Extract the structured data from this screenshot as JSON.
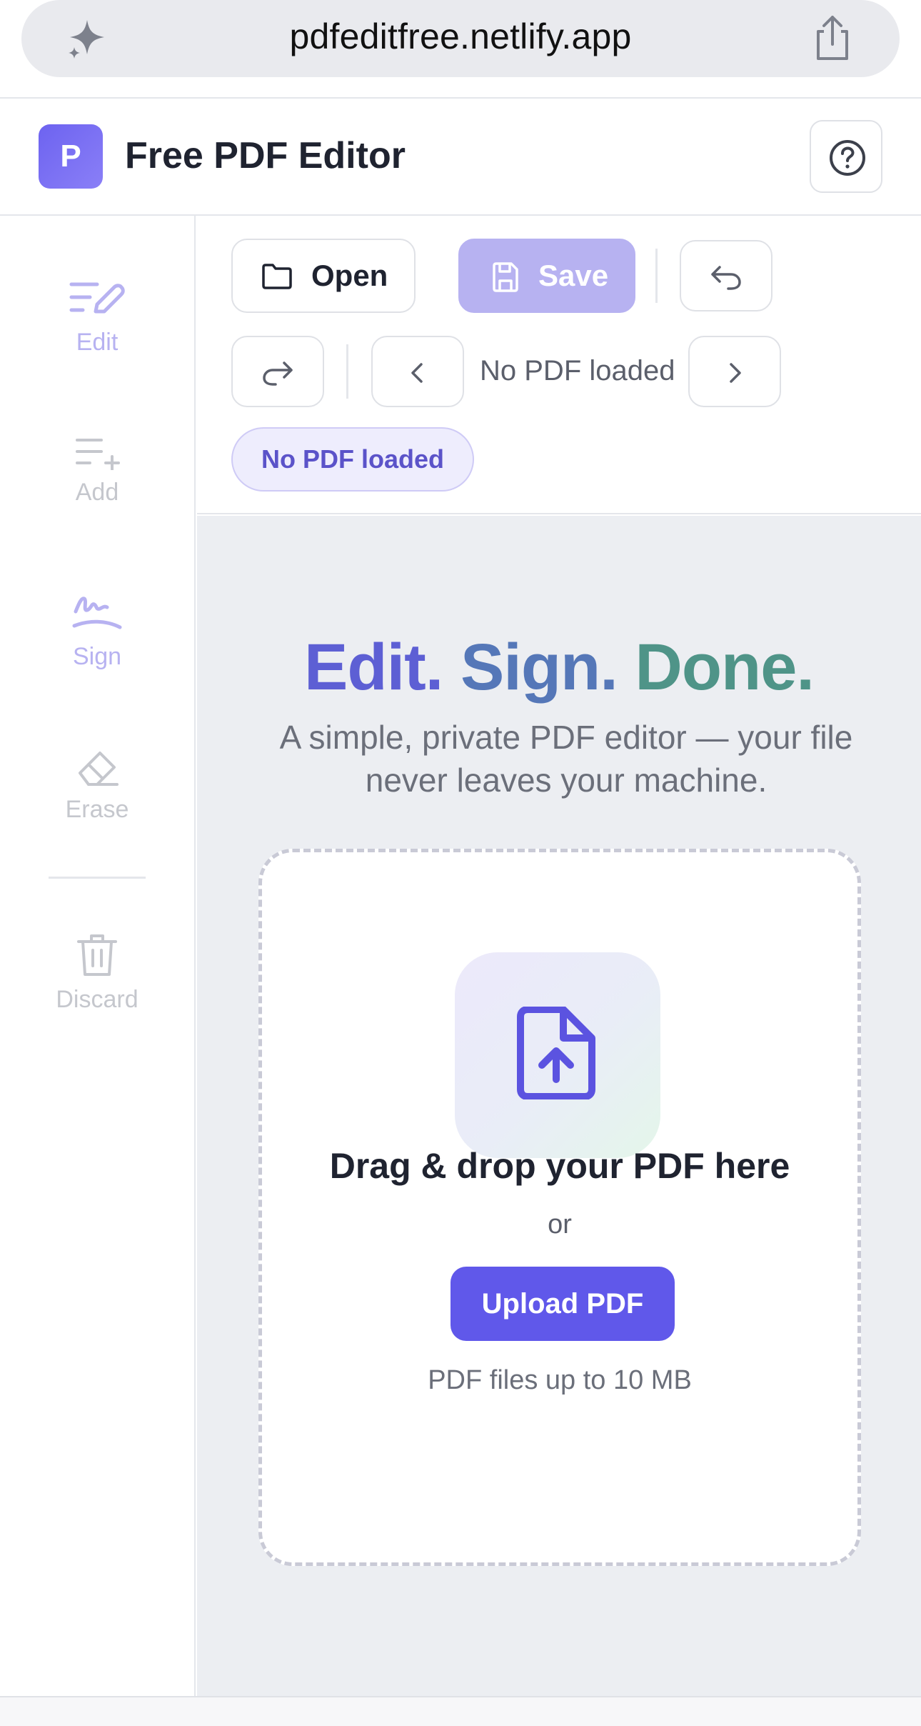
{
  "browser": {
    "url": "pdfeditfree.netlify.app",
    "left_icon": "sparkle-icon",
    "right_icon": "share-icon"
  },
  "header": {
    "logo_letter": "P",
    "title": "Free PDF Editor",
    "help_icon": "help-icon"
  },
  "sidebar": {
    "items": [
      {
        "label": "Edit",
        "icon": "edit-icon",
        "state": "active"
      },
      {
        "label": "Add",
        "icon": "add-icon",
        "state": "disabled"
      },
      {
        "label": "Sign",
        "icon": "sign-icon",
        "state": "active"
      },
      {
        "label": "Erase",
        "icon": "eraser-icon",
        "state": "disabled"
      },
      {
        "label": "Discard",
        "icon": "trash-icon",
        "state": "disabled"
      }
    ]
  },
  "toolbar": {
    "open_label": "Open",
    "save_label": "Save",
    "page_label": "No PDF loaded",
    "status_badge": "No PDF loaded"
  },
  "hero": {
    "word1": "Edit.",
    "word2": "Sign.",
    "word3": "Done.",
    "subtitle": "A simple, private PDF editor — your file never leaves your machine."
  },
  "dropzone": {
    "title": "Drag & drop your PDF here",
    "or": "or",
    "button": "Upload PDF",
    "note": "PDF files up to 10 MB"
  },
  "colors": {
    "accent": "#6058ea",
    "accent_disabled": "#b7b2f1",
    "hero_edit": "#5d5fd4",
    "hero_sign": "#5577b8",
    "hero_done": "#4f9488"
  }
}
